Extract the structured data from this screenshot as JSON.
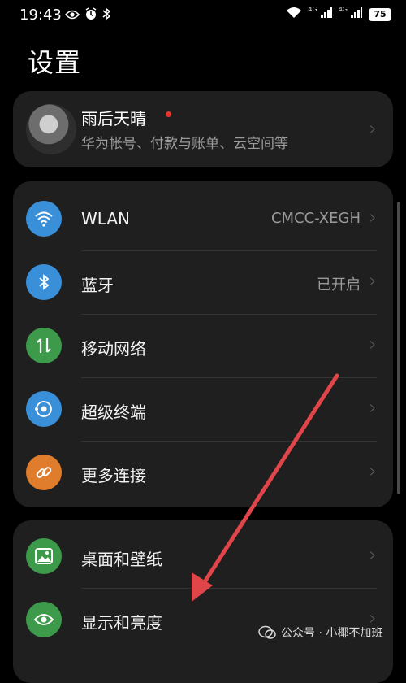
{
  "status_bar": {
    "time": "19:43",
    "network_labels": [
      "4G",
      "4G"
    ],
    "battery": "75"
  },
  "page_title": "设置",
  "account": {
    "name": "雨后天晴",
    "subtitle": "华为帐号、付款与账单、云空间等"
  },
  "groups": [
    {
      "items": [
        {
          "label": "WLAN",
          "value": "CMCC-XEGH",
          "icon": "wifi-icon",
          "color": "#3a8fd9"
        },
        {
          "label": "蓝牙",
          "value": "已开启",
          "icon": "bluetooth-icon",
          "color": "#3a8fd9"
        },
        {
          "label": "移动网络",
          "value": "",
          "icon": "mobile-data-icon",
          "color": "#3e9a4b"
        },
        {
          "label": "超级终端",
          "value": "",
          "icon": "super-device-icon",
          "color": "#3a8fd9"
        },
        {
          "label": "更多连接",
          "value": "",
          "icon": "link-icon",
          "color": "#e07d2c"
        }
      ]
    },
    {
      "items": [
        {
          "label": "桌面和壁纸",
          "value": "",
          "icon": "wallpaper-icon",
          "color": "#3e9a4b"
        },
        {
          "label": "显示和亮度",
          "value": "",
          "icon": "eye-icon",
          "color": "#3e9a4b"
        }
      ]
    }
  ],
  "watermark": {
    "text": "公众号 · 小椰不加班"
  },
  "colors": {
    "background": "#000000",
    "card": "#1f1f1f",
    "annotation_arrow": "#e0454a"
  }
}
